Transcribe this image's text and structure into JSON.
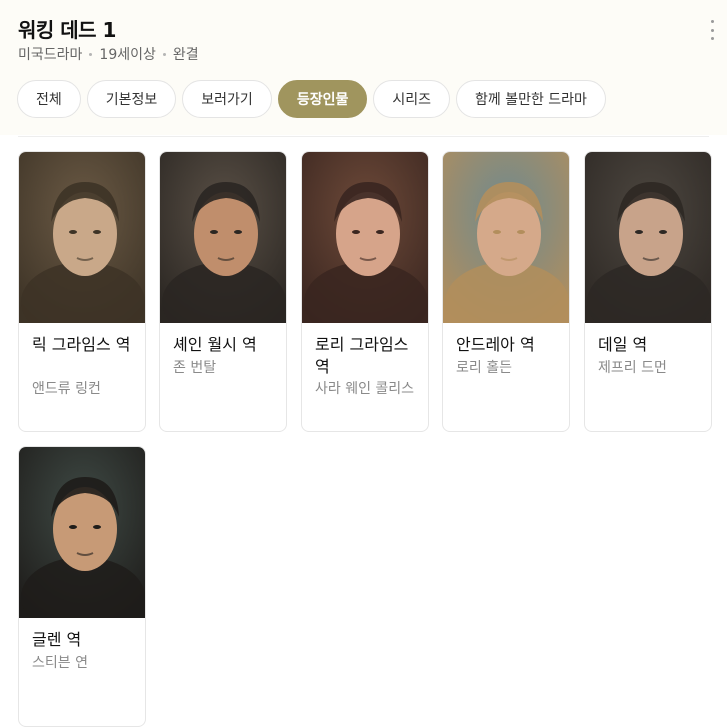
{
  "header": {
    "title": "워킹 데드 1",
    "meta": [
      "미국드라마",
      "19세이상",
      "완결"
    ]
  },
  "tabs": [
    {
      "label": "전체",
      "active": false
    },
    {
      "label": "기본정보",
      "active": false
    },
    {
      "label": "보러가기",
      "active": false
    },
    {
      "label": "등장인물",
      "active": true
    },
    {
      "label": "시리즈",
      "active": false
    },
    {
      "label": "함께 볼만한 드라마",
      "active": false
    }
  ],
  "cast": [
    {
      "role": "릭 그라임스 역",
      "actor": "앤드류 링컨",
      "photo_colors": [
        "#6b5a45",
        "#3d3326",
        "#c9a889"
      ]
    },
    {
      "role": "셰인 월시 역",
      "actor": "존 번탈",
      "photo_colors": [
        "#5a5046",
        "#2a2622",
        "#c08e6c"
      ]
    },
    {
      "role": "로리 그라임스 역",
      "actor": "사라 웨인 콜리스",
      "photo_colors": [
        "#6e4a39",
        "#3a2620",
        "#d6a48a"
      ]
    },
    {
      "role": "안드레아 역",
      "actor": "로리 홀든",
      "photo_colors": [
        "#6f8a8f",
        "#b28e5c",
        "#d5a98a"
      ]
    },
    {
      "role": "데일 역",
      "actor": "제프리 드먼",
      "photo_colors": [
        "#4d4740",
        "#2d2824",
        "#c8a38a"
      ]
    },
    {
      "role": "글렌 역",
      "actor": "스티븐 연",
      "photo_colors": [
        "#3f4a45",
        "#1e1c1a",
        "#c79a76"
      ]
    }
  ],
  "colors": {
    "accent": "#a0955e",
    "header_bg": "#fdfcf7"
  }
}
